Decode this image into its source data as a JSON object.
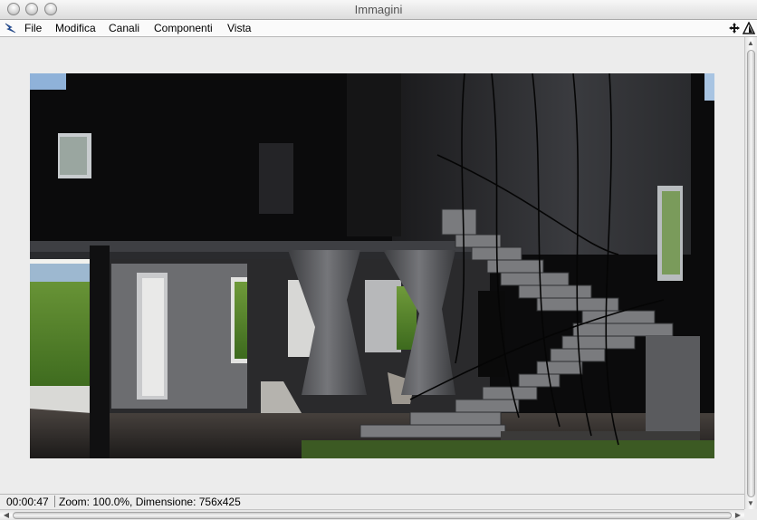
{
  "window": {
    "title": "Immagini"
  },
  "menubar": {
    "items": [
      {
        "label": "File"
      },
      {
        "label": "Modifica"
      },
      {
        "label": "Canali"
      },
      {
        "label": "Componenti"
      },
      {
        "label": "Vista"
      }
    ],
    "app_icon": "render-app-icon",
    "right_icons": [
      "move-icon",
      "triangle-warning-icon"
    ]
  },
  "viewer": {
    "image_description_icon": "rendered-interior-staircase-image"
  },
  "status": {
    "time": "00:00:47",
    "info": "Zoom: 100.0%, Dimensione: 756x425"
  },
  "scrollbars": {
    "vertical": "visible",
    "horizontal": "visible"
  }
}
